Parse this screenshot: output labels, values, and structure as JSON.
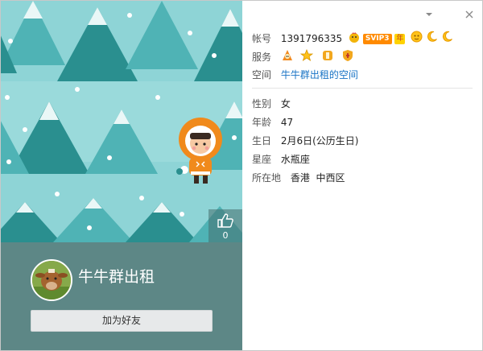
{
  "window": {
    "minimize_icon": "chevron-down-icon",
    "close_icon": "close-icon"
  },
  "profile": {
    "nickname": "牛牛群出租",
    "add_friend_label": "加为好友",
    "like_count": "0"
  },
  "info": {
    "account_label": "帐号",
    "account_value": "1391796335",
    "svip_badge": "SVIP3",
    "year_badge": "年",
    "service_label": "服务",
    "space_label": "空间",
    "space_link": "牛牛群出租的空间",
    "gender_label": "性别",
    "gender_value": "女",
    "age_label": "年龄",
    "age_value": "47",
    "birthday_label": "生日",
    "birthday_value": "2月6日(公历生日)",
    "zodiac_label": "星座",
    "zodiac_value": "水瓶座",
    "location_label": "所在地",
    "location_value": "香港  中西区"
  },
  "colors": {
    "bg_sky": "#8ed4d6",
    "tree_dark": "#2a8f8f",
    "tree_light": "#4fb3b5",
    "profile_band": "#5d8786",
    "link": "#1a74c5"
  }
}
